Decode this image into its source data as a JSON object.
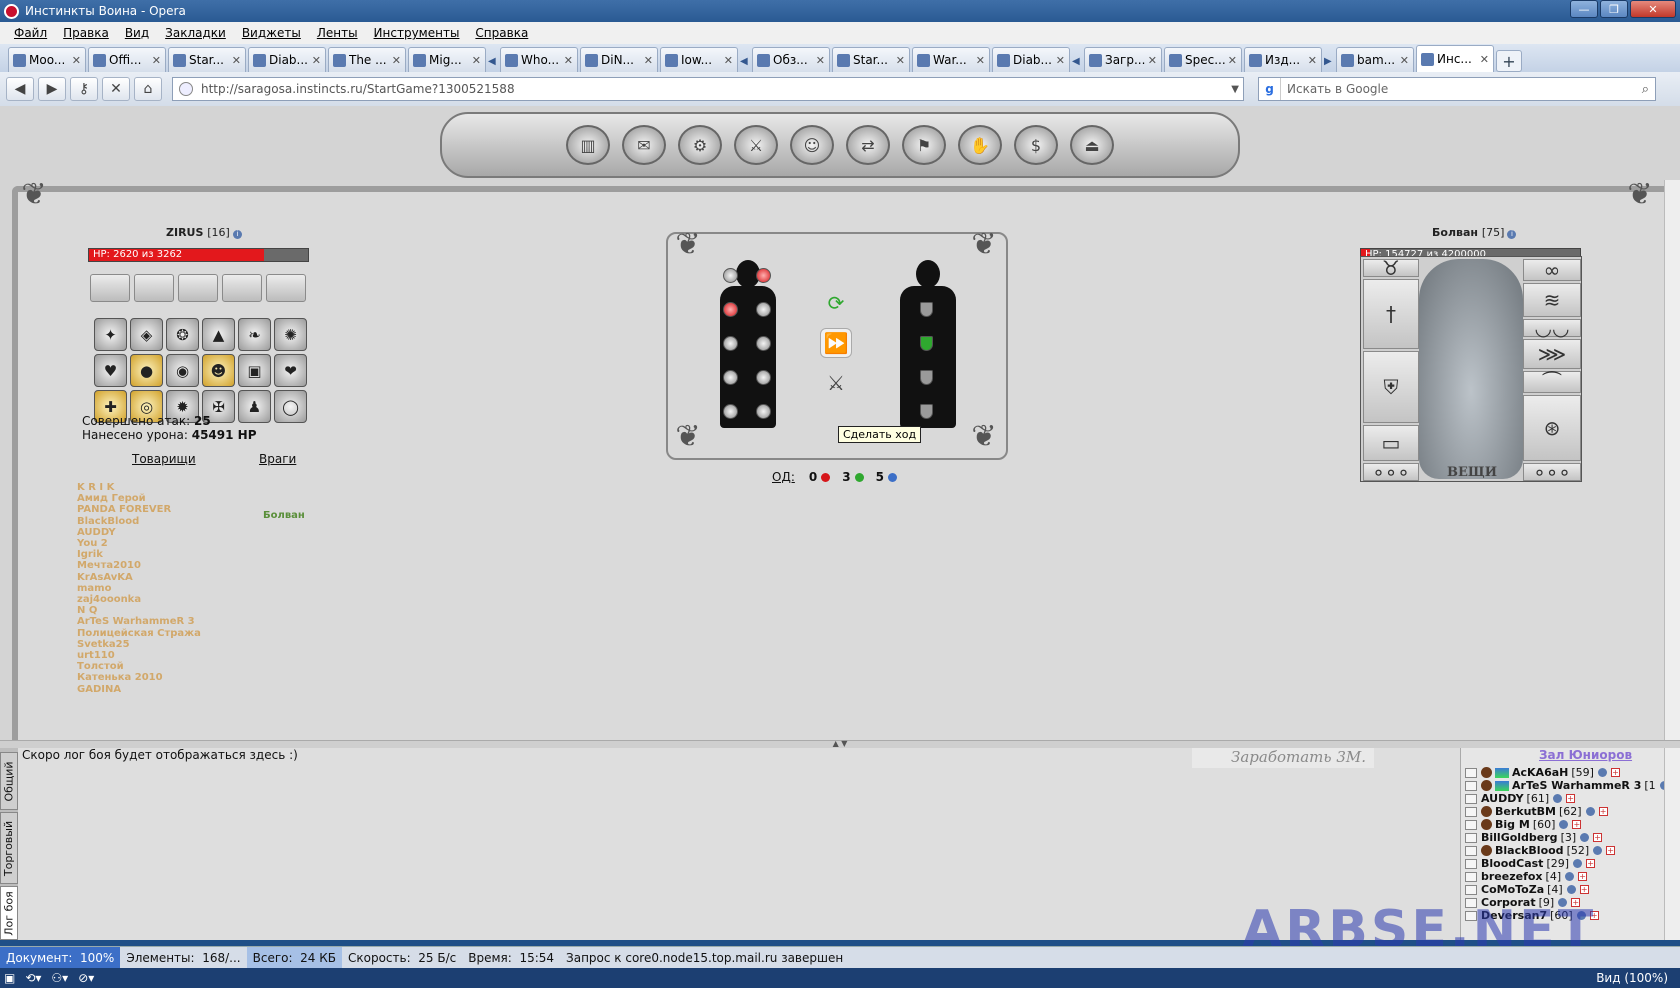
{
  "window": {
    "title": "Инстинкты Воина - Opera"
  },
  "menu": [
    "Файл",
    "Правка",
    "Вид",
    "Закладки",
    "Виджеты",
    "Ленты",
    "Инструменты",
    "Справка"
  ],
  "tabs": [
    {
      "label": "Moo..."
    },
    {
      "label": "Offi..."
    },
    {
      "label": "Star..."
    },
    {
      "label": "Diab..."
    },
    {
      "label": "The ..."
    },
    {
      "label": "Mig..."
    },
    {
      "label": "Who..."
    },
    {
      "label": "DiN..."
    },
    {
      "label": "Iow..."
    },
    {
      "label": "Обз..."
    },
    {
      "label": "Star..."
    },
    {
      "label": "War..."
    },
    {
      "label": "Diab..."
    },
    {
      "label": "Загр..."
    },
    {
      "label": "Spec..."
    },
    {
      "label": "Изд..."
    },
    {
      "label": "bam..."
    },
    {
      "label": "Инс..."
    }
  ],
  "address": {
    "url": "http://saragosa.instincts.ru/StartGame?1300521588",
    "search_placeholder": "Искать в Google"
  },
  "player": {
    "name": "ZIRUS",
    "level": "[16]",
    "hp_text": "HP: 2620 из 3262",
    "hp_fraction": 0.8,
    "attacks_label": "Совершено атак:",
    "attacks_value": "25",
    "damage_label": "Нанесено урона:",
    "damage_value": "45491 HP"
  },
  "enemy": {
    "name": "Болван",
    "level": "[75]",
    "hp_text": "HP: 154727 из 4200000",
    "hp_fraction": 0.04,
    "items_label": "ВЕЩИ"
  },
  "lists": {
    "comrades_label": "Товарищи",
    "enemies_label": "Враги",
    "allies": [
      "K R I K",
      "Амид Герой",
      "PANDA FOREVER",
      "BlackBlood",
      "AUDDY",
      "You 2",
      "Igrik",
      "Мечта2010",
      "KrAsAvKA",
      "mamo",
      "zaj4ooonka",
      "N Q",
      "ArTeS WarhammeR 3",
      "Полицейская Стража",
      "Svetka25",
      "urt110",
      "Толстой",
      "Катенька 2010",
      "GADINA"
    ],
    "enemies": [
      "Болван"
    ]
  },
  "battle": {
    "tooltip": "Сделать ход",
    "od_label": "ОД:",
    "od_red": "0",
    "od_green": "3",
    "od_blue": "5"
  },
  "bottom": {
    "log_text": "Скоро лог боя будет отображаться здесь :)",
    "earn_text": "Заработать 3M.",
    "vtabs": [
      "Общий",
      "Торговый",
      "Лог боя"
    ],
    "room_title": "Зал Юниоров",
    "users": [
      {
        "name": "AcKA6aH",
        "level": "[59]"
      },
      {
        "name": "ArTeS WarhammeR 3",
        "level": "[1"
      },
      {
        "name": "AUDDY",
        "level": "[61]"
      },
      {
        "name": "BerkutBM",
        "level": "[62]"
      },
      {
        "name": "Big M",
        "level": "[60]"
      },
      {
        "name": "BillGoldberg",
        "level": "[3]"
      },
      {
        "name": "BlackBlood",
        "level": "[52]"
      },
      {
        "name": "BloodCast",
        "level": "[29]"
      },
      {
        "name": "breezefox",
        "level": "[4]"
      },
      {
        "name": "CoMoToZa",
        "level": "[4]"
      },
      {
        "name": "Corporat",
        "level": "[9]"
      },
      {
        "name": "Deversan7",
        "level": "[60]"
      }
    ]
  },
  "watermark": "ARBSE.NET",
  "status": {
    "doc_label": "Документ:",
    "doc_value": "100%",
    "elements_label": "Элементы:",
    "elements_value": "168/...",
    "total_label": "Всего:",
    "total_value": "24 КБ",
    "speed_label": "Скорость:",
    "speed_value": "25 Б/с",
    "time_label": "Время:",
    "time_value": "15:54",
    "request_text": "Запрос к core0.node15.top.mail.ru завершен"
  },
  "taskbar": {
    "zoom": "Вид (100%)"
  }
}
